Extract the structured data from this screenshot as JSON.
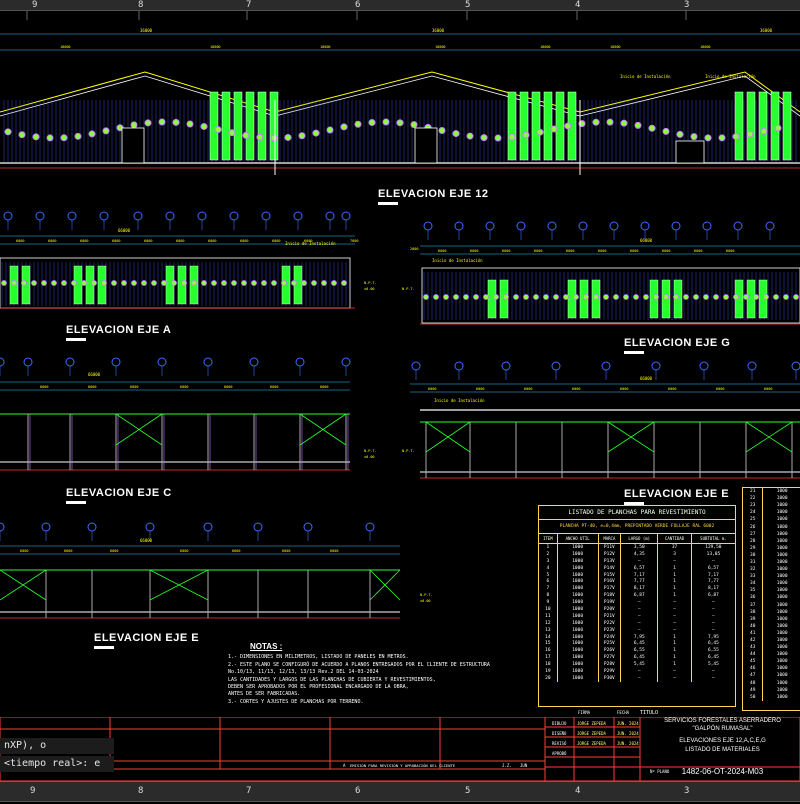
{
  "ruler": {
    "top": [
      "9",
      "8",
      "7",
      "6",
      "5",
      "4",
      "3"
    ],
    "bottom": [
      "9",
      "8",
      "7",
      "6",
      "5",
      "4",
      "3"
    ]
  },
  "elevations": {
    "eje12": "ELEVACION EJE 12",
    "ejeA": "ELEVACION EJE A",
    "ejeG": "ELEVACION EJE G",
    "ejeC": "ELEVACION EJE C",
    "ejeE1": "ELEVACION EJE E",
    "ejeE2": "ELEVACION EJE E"
  },
  "dims": {
    "d18000": "18000",
    "d36000": "36000",
    "d66000": "66000",
    "d6000": "6000",
    "d7000": "7000",
    "d2000": "2000",
    "npt": "N.P.T.",
    "npt_val": "±0.00",
    "inicio": "Inicio de Instalación"
  },
  "notes": {
    "title": "NOTAS :",
    "lines": [
      "1.- DIMENSIONES EN MILIMETROS, LISTADO DE PANELES EN METROS.",
      "2.- ESTE PLANO SE CONFIGURÓ DE ACUERDO A PLANOS ENTREGADOS POR EL CLIENTE DE ESTRUCTURA",
      "    No.10/13, 11/13, 12/13, 13/13 Rev.2 DEL 14-03-2024",
      "    LAS CANTIDADES Y LARGOS DE LAS PLANCHAS DE CUBIERTA Y REVESTIMIENTOS,",
      "    DEBEN SER APROBADOS POR EL PROFESIONAL ENCARGADO DE LA OBRA,",
      "    ANTES DE SER FABRICADAS.",
      "3.- CORTES Y AJUSTES DE PLANCHAS POR TERRENO."
    ]
  },
  "material_list": {
    "title": "LISTADO DE PLANCHAS PARA REVESTIMIENTO",
    "subtitle": "PLANCHA PT-40, e=0,4mm, PREPINTADO VERDE FOLLAJE RAL 6002",
    "headers": [
      "ITEM",
      "ANCHO UTIL",
      "MARCA",
      "LARGO (m)",
      "CANTIDAD",
      "SUBTOTAL m."
    ],
    "rows": [
      [
        "1",
        "1000",
        "P11V",
        "3,50",
        "37",
        "129,50"
      ],
      [
        "2",
        "1000",
        "P12V",
        "4,35",
        "3",
        "13,05"
      ],
      [
        "3",
        "1000",
        "P13V",
        "—",
        "—",
        "—"
      ],
      [
        "4",
        "1000",
        "P14V",
        "6,57",
        "1",
        "6,57"
      ],
      [
        "5",
        "1000",
        "P15V",
        "7,17",
        "1",
        "7,17"
      ],
      [
        "6",
        "1000",
        "P16V",
        "7,77",
        "1",
        "7,77"
      ],
      [
        "7",
        "1000",
        "P17V",
        "8,17",
        "1",
        "8,17"
      ],
      [
        "8",
        "1000",
        "P18V",
        "6,87",
        "1",
        "6,87"
      ],
      [
        "9",
        "1000",
        "P19V",
        "—",
        "—",
        "—"
      ],
      [
        "10",
        "1000",
        "P20V",
        "—",
        "—",
        "—"
      ],
      [
        "11",
        "1000",
        "P21V",
        "—",
        "—",
        "—"
      ],
      [
        "12",
        "1000",
        "P22V",
        "—",
        "—",
        "—"
      ],
      [
        "13",
        "1000",
        "P23V",
        "—",
        "—",
        "—"
      ],
      [
        "14",
        "1000",
        "P24V",
        "7,95",
        "1",
        "7,95"
      ],
      [
        "15",
        "1000",
        "P25V",
        "6,45",
        "1",
        "6,45"
      ],
      [
        "16",
        "1000",
        "P26V",
        "6,55",
        "1",
        "6,55"
      ],
      [
        "17",
        "1000",
        "P27V",
        "6,45",
        "1",
        "6,45"
      ],
      [
        "18",
        "1000",
        "P28V",
        "5,45",
        "1",
        "5,45"
      ],
      [
        "19",
        "1000",
        "P29V",
        "—",
        "—",
        "—"
      ],
      [
        "20",
        "1000",
        "P30V",
        "—",
        "—",
        "—"
      ]
    ]
  },
  "side_list": {
    "rows": [
      [
        "21",
        "1000"
      ],
      [
        "22",
        "1000"
      ],
      [
        "23",
        "1000"
      ],
      [
        "24",
        "1000"
      ],
      [
        "25",
        "1000"
      ],
      [
        "26",
        "1000"
      ],
      [
        "27",
        "1000"
      ],
      [
        "28",
        "1000"
      ],
      [
        "29",
        "1000"
      ],
      [
        "30",
        "1000"
      ],
      [
        "31",
        "1000"
      ],
      [
        "32",
        "1000"
      ],
      [
        "33",
        "1000"
      ],
      [
        "34",
        "1000"
      ],
      [
        "35",
        "1000"
      ],
      [
        "36",
        "1000"
      ],
      [
        "37",
        "1000"
      ],
      [
        "38",
        "1000"
      ],
      [
        "39",
        "1000"
      ],
      [
        "40",
        "1000"
      ],
      [
        "41",
        "1000"
      ],
      [
        "42",
        "1000"
      ],
      [
        "43",
        "1000"
      ],
      [
        "44",
        "1000"
      ],
      [
        "45",
        "1000"
      ],
      [
        "46",
        "1000"
      ],
      [
        "47",
        "1000"
      ],
      [
        "48",
        "1000"
      ],
      [
        "49",
        "1000"
      ],
      [
        "50",
        "1000"
      ]
    ]
  },
  "title_block": {
    "titulo": "TITULO",
    "project": "SERVICIOS FORESTALES ASERRADERO",
    "project2": "\"GALPÓN RUMASAL\"",
    "sheet": "ELEVACIONES EJE 12,A,C,E,G",
    "sheet2": "LISTADO DE MATERIALES",
    "code": "1482-06-OT-2024-M03",
    "firma": "FIRMA",
    "fecha": "FECHA",
    "dibujo": "DIBUJO",
    "diseno": "DISEÑO",
    "reviso": "REVISÓ",
    "aprobo": "APROBÓ",
    "name1": "JORGE ZEPEDA",
    "date1": "JUN. 2024",
    "name2": "JORGE ZEPEDA",
    "date2": "JUN. 2024",
    "name3": "JORGE ZEPEDA",
    "date3": "JUN. 2024",
    "rev_a": "A",
    "rev_text": "EMISIÓN PARA REVISIÓN Y APROBACIÓN DEL CLIENTE",
    "rev_by": "J.Z.",
    "rev_date": "JUN",
    "nplano": "Nº PLANO"
  },
  "cmd": {
    "line1": "nXP), o",
    "line2": "<tiempo real>: e"
  }
}
